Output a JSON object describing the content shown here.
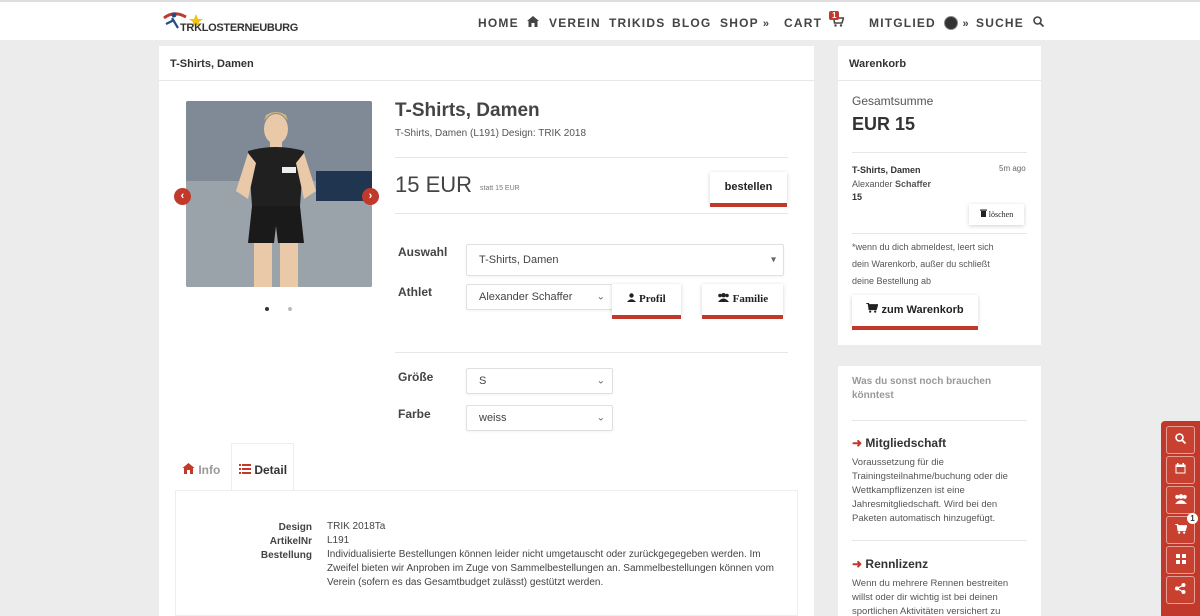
{
  "brand": {
    "logo_text": "TRKLOSTERNEUBURG"
  },
  "nav": {
    "home": "HOME",
    "verein": "VEREIN",
    "trikids": "TRIKIDS",
    "blog": "BLOG",
    "shop": "SHOP",
    "cart": "CART",
    "cart_count": "1",
    "mitglied": "MITGLIED",
    "suche": "SUCHE"
  },
  "product_panel": {
    "header": "T-Shirts, Damen",
    "title": "T-Shirts, Damen",
    "subtitle": "T-Shirts, Damen (L191) Design: TRIK 2018",
    "price": "15 EUR",
    "price_note": "statt 15 EUR",
    "order_button": "bestellen",
    "auswahl_label": "Auswahl",
    "auswahl_value": "T-Shirts, Damen",
    "athlet_label": "Athlet",
    "athlet_value": "Alexander Schaffer",
    "profil_button": "Profil",
    "familie_button": "Familie",
    "groesse_label": "Größe",
    "groesse_value": "S",
    "farbe_label": "Farbe",
    "farbe_value": "weiss",
    "tabs": {
      "info": "Info",
      "detail": "Detail"
    },
    "details": {
      "design_label": "Design",
      "design_value": "TRIK 2018Ta",
      "artikel_label": "ArtikelNr",
      "artikel_value": "L191",
      "bestellung_label": "Bestellung",
      "bestellung_value": "Individualisierte Bestellungen können leider nicht umgetauscht oder zurückgegegeben werden. Im Zweifel bieten wir Anproben im Zuge von Sammelbestellungen an. Sammelbestellungen können vom Verein (sofern es das Gesamtbudget zulässt) gestützt werden."
    }
  },
  "cart_panel": {
    "header": "Warenkorb",
    "total_label": "Gesamtsumme",
    "total_value": "EUR 15",
    "item_title": "T-Shirts, Damen",
    "item_time": "5m ago",
    "item_name_first": "Alexander",
    "item_name_last": "Schaffer",
    "item_price": "15",
    "delete_button": "löschen",
    "note": "*wenn du dich abmeldest, leert sich dein Warenkorb, außer du schließt deine Bestellung ab",
    "to_cart_button": "zum Warenkorb"
  },
  "suggest_panel": {
    "heading": "Was du sonst noch brauchen könntest",
    "items": [
      {
        "title": "Mitgliedschaft",
        "text": "Voraussetzung für die Trainingsteilnahme/buchung oder die Wettkampflizenzen ist eine Jahresmitgliedschaft. Wird bei den Paketen automatisch hinzugefügt."
      },
      {
        "title": "Rennlizenz",
        "text": "Wenn du mehrere Rennen bestreiten willst oder dir wichtig ist bei deinen sportlichen Aktivitäten versichert zu"
      }
    ]
  },
  "side_tools": {
    "cart_badge": "1"
  },
  "colors": {
    "accent": "#c0392b"
  },
  "icons": [
    "home-icon",
    "chevron-double-down-icon",
    "cart-icon",
    "avatar-icon",
    "search-icon",
    "arrow-left-icon",
    "arrow-right-icon",
    "user-icon",
    "users-icon",
    "list-icon",
    "trash-icon",
    "arrow-right-icon",
    "calendar-icon",
    "grid-icon",
    "share-icon"
  ]
}
